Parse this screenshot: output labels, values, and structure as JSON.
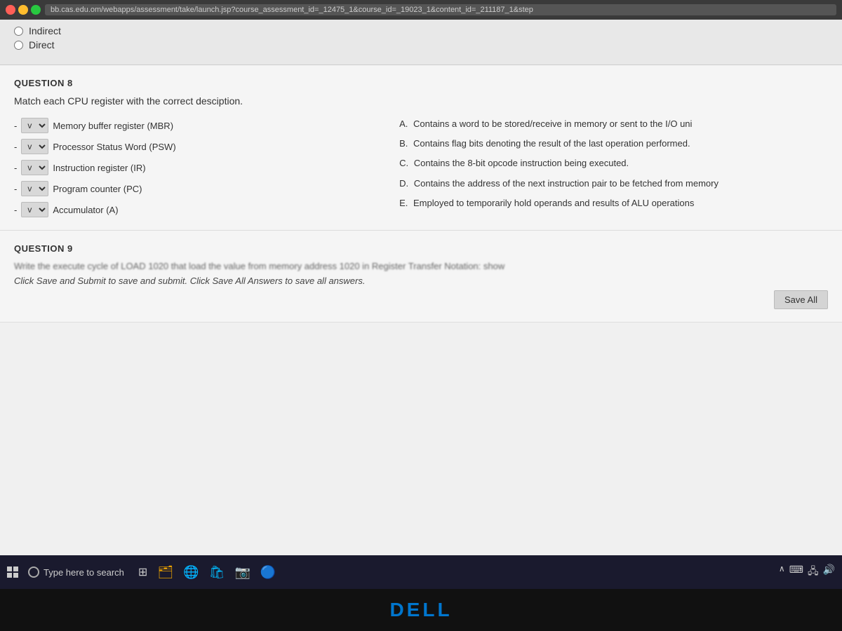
{
  "browser": {
    "url": "bb.cas.edu.om/webapps/assessment/take/launch.jsp?course_assessment_id=_12475_1&course_id=_19023_1&content_id=_211187_1&step"
  },
  "top_radio": {
    "indirect_label": "Indirect",
    "direct_label": "Direct"
  },
  "question8": {
    "label": "QUESTION 8",
    "text": "Match each CPU register with the correct desciption.",
    "left_items": [
      {
        "id": "mbr",
        "label": "Memory buffer register (MBR)"
      },
      {
        "id": "psw",
        "label": "Processor Status Word (PSW)"
      },
      {
        "id": "ir",
        "label": "Instruction register (IR)"
      },
      {
        "id": "pc",
        "label": "Program counter (PC)"
      },
      {
        "id": "acc",
        "label": "Accumulator (A)"
      }
    ],
    "right_items": [
      {
        "letter": "A.",
        "text": "Contains a word to be stored/receive in memory or sent to the I/O uni"
      },
      {
        "letter": "B.",
        "text": "Contains flag bits denoting the result of the last operation performed."
      },
      {
        "letter": "C.",
        "text": "Contains the 8-bit opcode instruction being executed."
      },
      {
        "letter": "D.",
        "text": "Contains the address of the next instruction pair to be fetched from memory"
      },
      {
        "letter": "E.",
        "text": "Employed to temporarily hold operands and results of ALU operations"
      }
    ]
  },
  "question9": {
    "label": "QUESTION 9",
    "text": "Write the execute cycle of LOAD 1020 that load the value from memory address 1020 in Register Transfer Notation: show",
    "instructions": "Click Save and Submit to save and submit. Click Save All Answers to save all answers.",
    "save_all_label": "Save All"
  },
  "taskbar": {
    "search_placeholder": "Type here to search",
    "dell_logo": "DELL"
  }
}
